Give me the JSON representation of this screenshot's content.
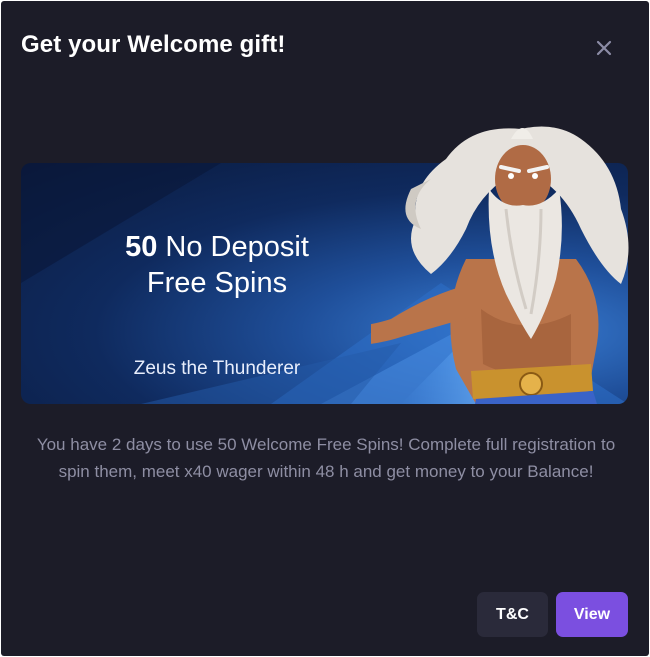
{
  "modal": {
    "title": "Get your Welcome gift!",
    "close_icon": "close-icon"
  },
  "banner": {
    "headline_number": "50",
    "headline_rest": "No Deposit",
    "headline_line2": "Free Spins",
    "game_name": "Zeus the Thunderer",
    "character": "zeus-illustration"
  },
  "description": "You have 2 days to use 50 Welcome Free Spins! Complete full registration to spin them, meet x40 wager within 48 h and get money to your Balance!",
  "buttons": {
    "tc_label": "T&C",
    "view_label": "View"
  },
  "colors": {
    "background": "#1c1c28",
    "accent": "#7b4fe0",
    "secondary_button": "#2a2a3a",
    "text_muted": "#8e8ea3"
  }
}
